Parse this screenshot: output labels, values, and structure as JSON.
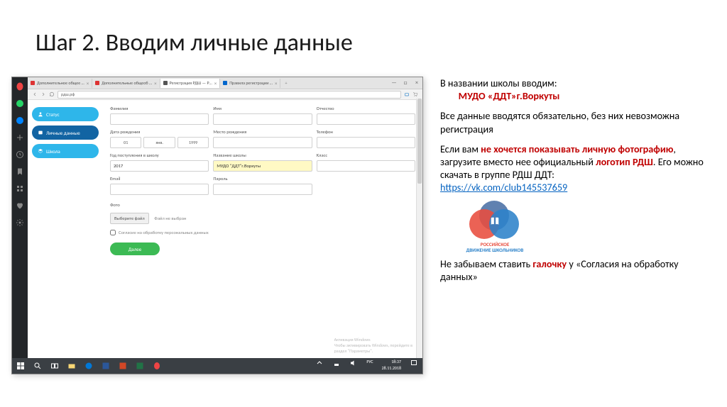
{
  "slide": {
    "title": "Шаг 2. Вводим личные данные"
  },
  "tabs": [
    {
      "label": "Дополнительное общее …",
      "color": "#d33"
    },
    {
      "label": "Дополнительные общеоб …",
      "color": "#d33"
    },
    {
      "label": "Регистрация РДШ — Р…",
      "color": "#333",
      "active": true
    },
    {
      "label": "Правила регистрации …",
      "color": "#06c"
    }
  ],
  "address": "рдш.рф",
  "sidebar": {
    "status": "Статус",
    "personal": "Личные данные",
    "school": "Школа"
  },
  "form": {
    "surname": "Фамилия",
    "name": "Имя",
    "patronymic": "Отчество",
    "dob": "Дата рождения",
    "day": "01",
    "month": "янв.",
    "year": "1999",
    "birthplace": "Место рождения",
    "phone": "Телефон",
    "enroll_year_label": "Год поступления в школу",
    "enroll_year": "2017",
    "school_label": "Название школы",
    "school_value": "МУДО \"ДДТ\"г.Воркуты",
    "class_label": "Класс",
    "email": "Email",
    "password": "Пароль",
    "photo": "Фото",
    "file_btn": "Выберите файл",
    "file_none": "Файл не выбран",
    "consent": "Согласие на обработку персональных данных",
    "next": "Далее"
  },
  "watermark": {
    "l1": "Активация Windows",
    "l2": "Чтобы активировать Windows, перейдите в",
    "l3": "раздел \"Параметры\"."
  },
  "taskbar": {
    "lang": "РУС",
    "time": "18:37",
    "date": "28.11.2018"
  },
  "side": {
    "p1": "В названии школы вводим:",
    "p1b": "МУДО «ДДТ»г.Воркуты",
    "p2": "Все данные вводятся обязательно, без них невозможна регистрация",
    "p3a": "Если вам ",
    "p3b": "не хочется показывать личную фотографию",
    "p3c": ", загрузите вместо нее официальный ",
    "p3d": "логотип РДШ",
    "p3e": ". Его можно скачать в группе РДШ ДДТ:",
    "link": "https://vk.com/club145537659",
    "logo_l1": "РОССИЙСКОЕ",
    "logo_l2": "ДВИЖЕНИЕ ШКОЛЬНИКОВ",
    "p4a": "Не забываем ставить ",
    "p4b": "галочку",
    "p4c": " у «Согласия на обработку данных»"
  }
}
